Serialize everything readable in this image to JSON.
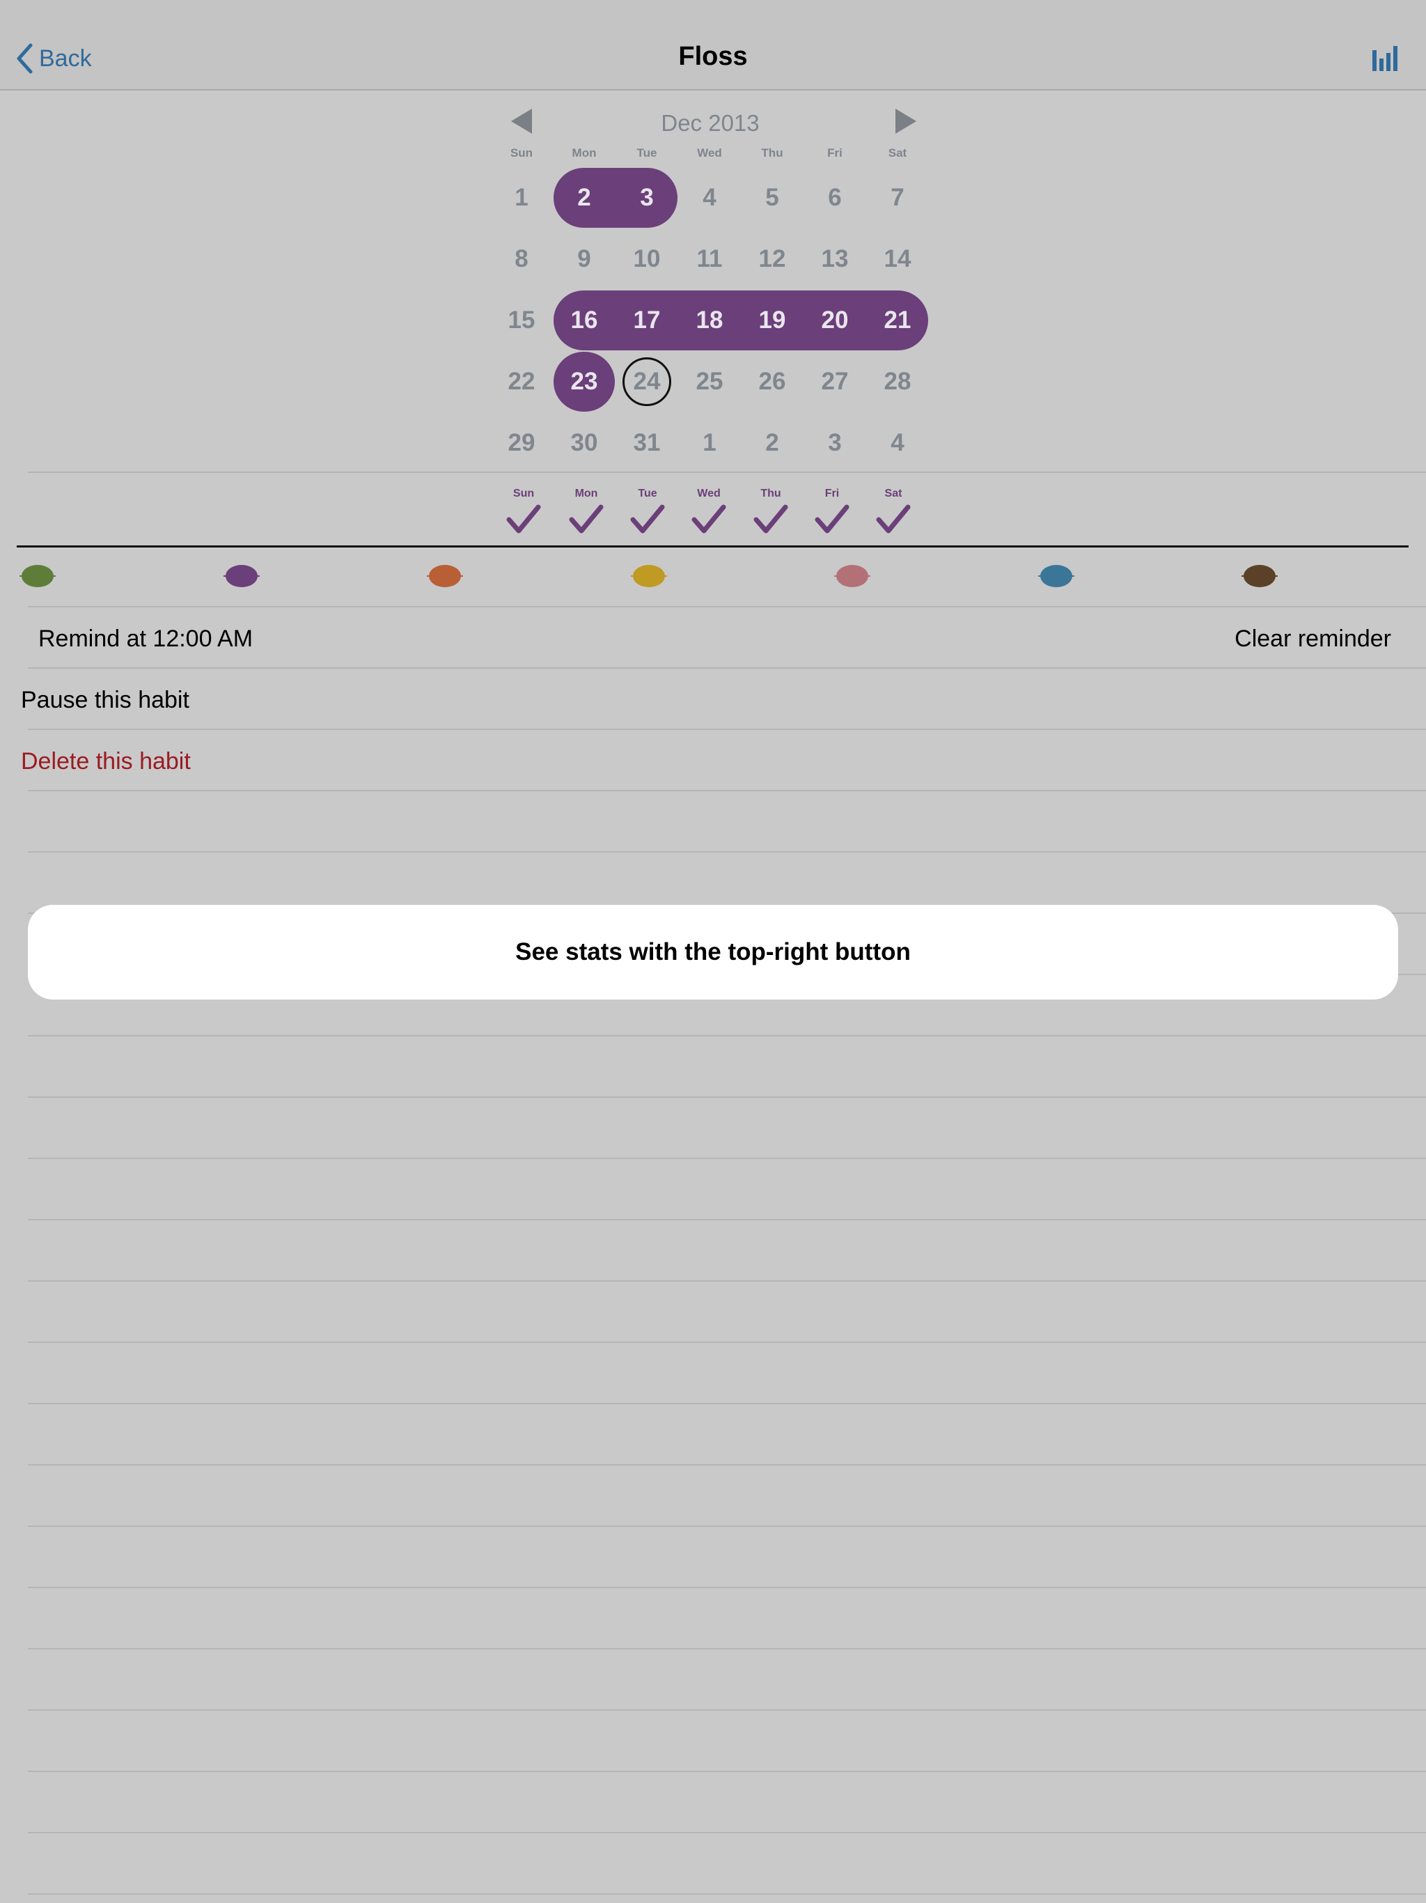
{
  "nav": {
    "back_label": "Back",
    "title": "Floss"
  },
  "calendar": {
    "month_title": "Dec 2013",
    "weekday_labels": [
      "Sun",
      "Mon",
      "Tue",
      "Wed",
      "Thu",
      "Fri",
      "Sat"
    ],
    "weeks": [
      [
        "1",
        "2",
        "3",
        "4",
        "5",
        "6",
        "7"
      ],
      [
        "8",
        "9",
        "10",
        "11",
        "12",
        "13",
        "14"
      ],
      [
        "15",
        "16",
        "17",
        "18",
        "19",
        "20",
        "21"
      ],
      [
        "22",
        "23",
        "24",
        "25",
        "26",
        "27",
        "28"
      ],
      [
        "29",
        "30",
        "31",
        "1",
        "2",
        "3",
        "4"
      ]
    ],
    "completed_days": [
      "2",
      "3",
      "16",
      "17",
      "18",
      "19",
      "20",
      "21",
      "23"
    ],
    "today": "24",
    "completed_color": "#6b3f79"
  },
  "weekly_schedule": {
    "labels": [
      "Sun",
      "Mon",
      "Tue",
      "Wed",
      "Thu",
      "Fri",
      "Sat"
    ],
    "checked": [
      true,
      true,
      true,
      true,
      true,
      true,
      true
    ]
  },
  "color_options": [
    "#5e7d38",
    "#6b3f79",
    "#b85f35",
    "#bf9b23",
    "#b37177",
    "#3b7699",
    "#5b4127"
  ],
  "reminder": {
    "label": "Remind at 12:00 AM",
    "clear_label": "Clear reminder"
  },
  "actions": {
    "pause_label": "Pause this habit",
    "delete_label": "Delete this habit"
  },
  "toast": {
    "message": "See stats with the top-right button"
  },
  "colors": {
    "accent_blue": "#2f6a9b",
    "danger_red": "#9b1a22",
    "background": "#c9c9c9"
  }
}
